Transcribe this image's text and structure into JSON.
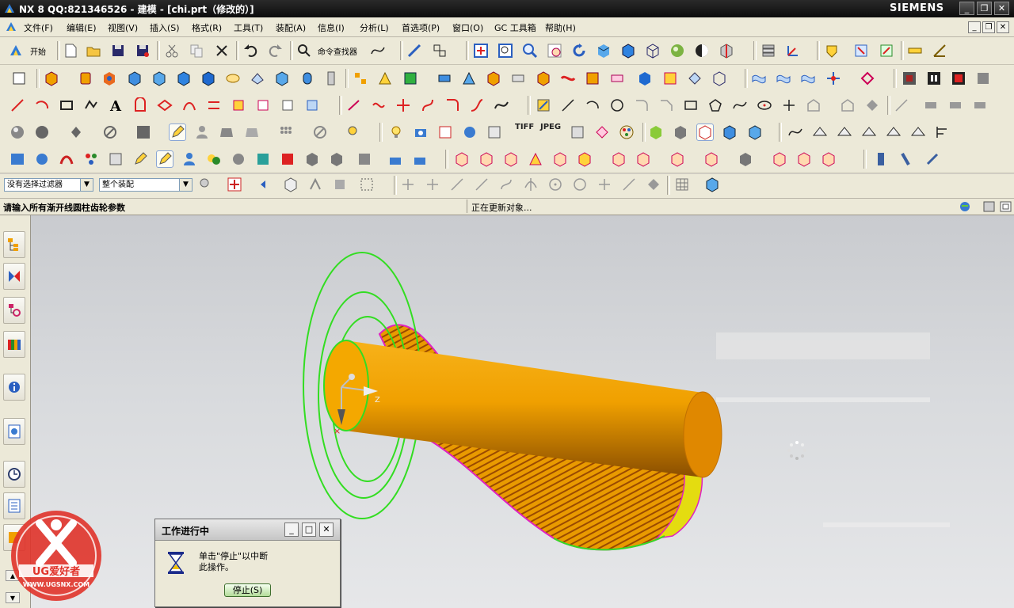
{
  "window": {
    "title": "NX 8   QQ:821346526 - 建模 - [chi.prt（修改的）]",
    "brand": "SIEMENS",
    "minimize": "_",
    "maximize": "❐",
    "close": "✕"
  },
  "menu": {
    "items": [
      {
        "label": "文件(F)"
      },
      {
        "label": "编辑(E)"
      },
      {
        "label": "视图(V)"
      },
      {
        "label": "插入(S)"
      },
      {
        "label": "格式(R)"
      },
      {
        "label": "工具(T)"
      },
      {
        "label": "装配(A)"
      },
      {
        "label": "信息(I)"
      },
      {
        "label": "分析(L)"
      },
      {
        "label": "首选项(P)"
      },
      {
        "label": "窗口(O)"
      },
      {
        "label": "GC 工具箱"
      },
      {
        "label": "帮助(H)"
      }
    ]
  },
  "toolbar": {
    "start_label": "开始",
    "command_finder_label": "命令查找器",
    "tiff_label": "TIFF",
    "jpeg_label": "JPEG"
  },
  "selection": {
    "filter_value": "没有选择过滤器",
    "scope_value": "整个装配"
  },
  "cue": {
    "prompt": "请输入所有渐开线圆柱齿轮参数",
    "status": "正在更新对象..."
  },
  "dialog": {
    "title": "工作进行中",
    "message_line1": "单击\"停止\"以中断",
    "message_line2": "此操作。",
    "stop_label": "停止(S)"
  },
  "logo": {
    "text": "UG爱好者",
    "url_text": "WWW.UGSNX.COM"
  },
  "colors": {
    "part_orange": "#f0a000",
    "helix_green": "#33dd22",
    "edge_magenta": "#e020c0"
  }
}
